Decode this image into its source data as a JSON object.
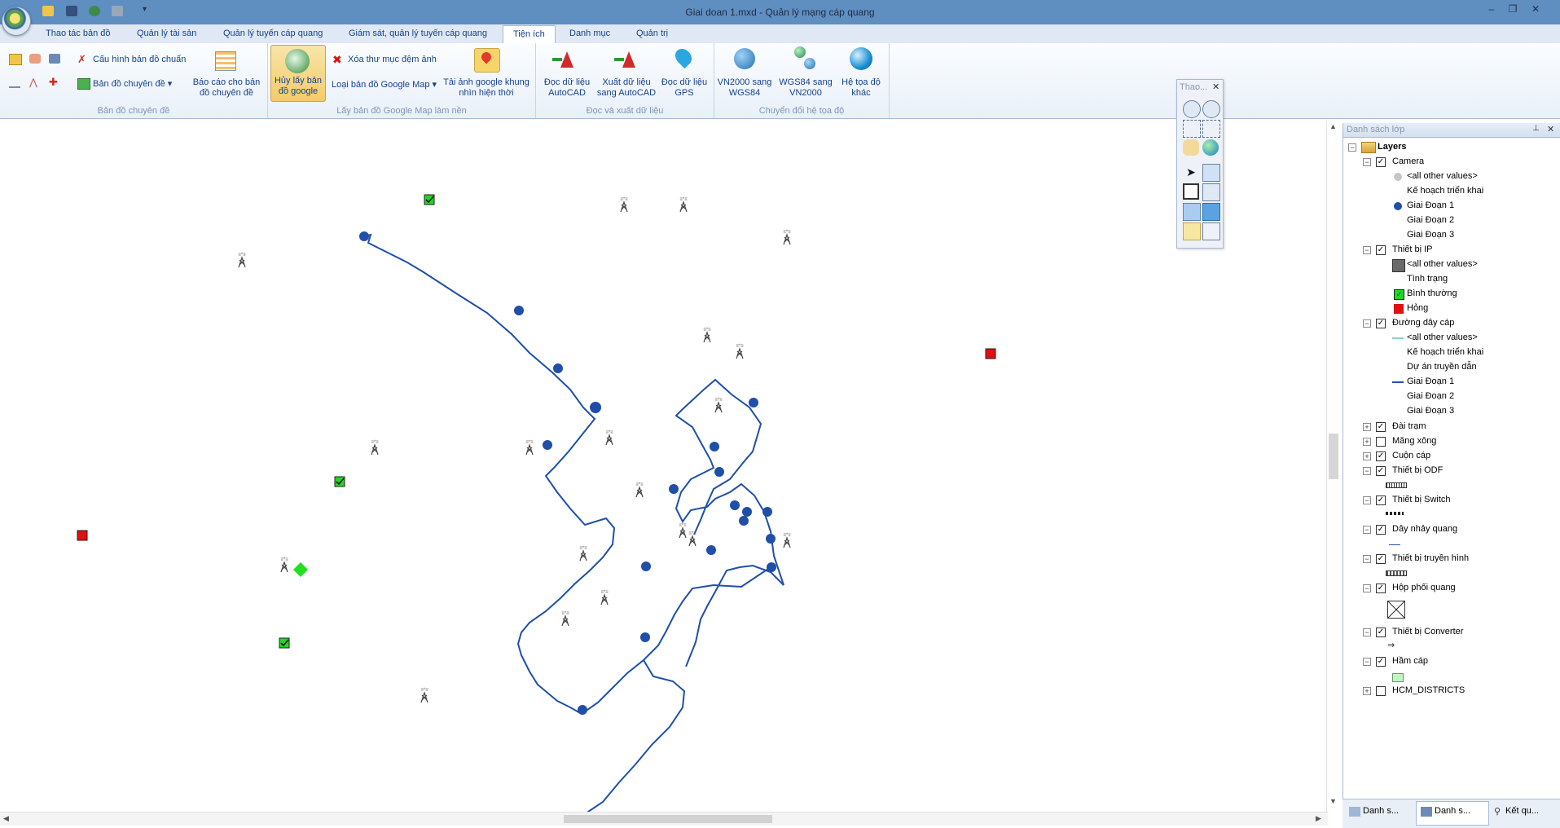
{
  "window": {
    "title": "Giai doan 1.mxd - Quản lý mạng cáp quang"
  },
  "colors": {
    "titlebar": "#5f8ec1",
    "cable": "#1f4fa8",
    "ok": "#20d820",
    "broken": "#e01010"
  },
  "tabs": [
    {
      "label": "Thao tác bản đồ"
    },
    {
      "label": "Quản lý tài sản"
    },
    {
      "label": "Quản lý tuyến cáp quang"
    },
    {
      "label": "Giám sát, quản lý tuyến cáp quang"
    },
    {
      "label": "Tiện ích",
      "active": true
    },
    {
      "label": "Danh mục"
    },
    {
      "label": "Quản trị"
    }
  ],
  "ribbon": {
    "groups": [
      {
        "label": "Bản đồ chuyên đề"
      },
      {
        "label": "Lấy bản đồ Google Map làm nền"
      },
      {
        "label": "Đọc và xuất dữ liệu"
      },
      {
        "label": "Chuyển đổi hệ tọa độ"
      }
    ],
    "cfg_label": "Cấu hình bản đồ chuẩn",
    "thematic_label": "Bản đồ chuyên đề",
    "report_label": "Báo cáo cho bản đồ chuyên đề",
    "cancel_google_label": "Hủy lấy bản đồ google",
    "clear_cache_label": "Xóa thư mục đệm ảnh",
    "google_type_label": "Loại bản đồ Google Map",
    "download_label": "Tải ảnh google khung nhìn hiện thời",
    "read_cad_label": "Đọc dữ liệu AutoCAD",
    "export_cad_label": "Xuất dữ liệu sang AutoCAD",
    "read_gps_label": "Đọc dữ liệu GPS",
    "vn2wgs_label": "VN2000 sang WGS84",
    "wgs2vn_label": "WGS84 sang VN2000",
    "other_label": "Hệ tọa độ khác"
  },
  "float_toolbar": {
    "title": "Thao..."
  },
  "layers": {
    "title": "Danh sách lớp",
    "root": "Layers",
    "camera": "Camera",
    "camera_other": "<all other values>",
    "camera_plan": "Kế hoạch triển khai",
    "camera_g1": "Giai Đoạn 1",
    "camera_g2": "Giai Đoạn 2",
    "camera_g3": "Giai Đoạn 3",
    "ip": "Thiết bị IP",
    "ip_other": "<all other values>",
    "ip_status": "Tình trạng",
    "ip_normal": "Bình thường",
    "ip_broken": "Hỏng",
    "cable": "Đường dây cáp",
    "cable_other": "<all other values>",
    "cable_plan": "Kế hoạch triển khai",
    "cable_proj": "Dự án truyền dẫn",
    "cable_g1": "Giai Đoạn 1",
    "cable_g2": "Giai Đoạn 2",
    "cable_g3": "Giai Đoạn 3",
    "station": "Đài trạm",
    "duct": "Măng xông",
    "coil": "Cuộn cáp",
    "odf": "Thiết bị ODF",
    "switch": "Thiết bị Switch",
    "patch": "Dây nhảy quang",
    "tv": "Thiết bị truyền hình",
    "box": "Hộp phối quang",
    "converter": "Thiết bị Converter",
    "manhole": "Hầm cáp",
    "districts": "HCM_DISTRICTS"
  },
  "bottom_tabs": [
    "Danh s...",
    "Danh s...",
    "Kết qu..."
  ]
}
